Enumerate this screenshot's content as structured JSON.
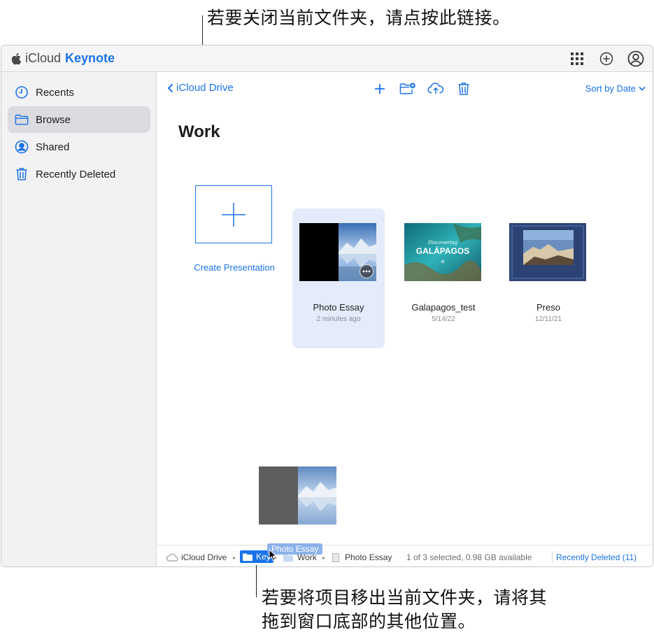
{
  "annotations": {
    "top": "若要关闭当前文件夹，请点按此链接。",
    "bottom_line1": "若要将项目移出当前文件夹，请将其",
    "bottom_line2": "拖到窗口底部的其他位置。"
  },
  "app": {
    "brand_icloud": "iCloud",
    "brand_app": "Keynote",
    "accent_color": "#1a73e8"
  },
  "top_icons": [
    "grid-icon",
    "add-circle-icon",
    "account-icon"
  ],
  "sidebar": {
    "items": [
      {
        "label": "Recents",
        "icon": "clock-icon"
      },
      {
        "label": "Browse",
        "icon": "folder-icon",
        "active": true
      },
      {
        "label": "Shared",
        "icon": "person-circle-icon"
      },
      {
        "label": "Recently Deleted",
        "icon": "trash-icon"
      }
    ]
  },
  "main": {
    "back_label": "iCloud Drive",
    "sort_label": "Sort by Date",
    "folder_title": "Work",
    "create_label": "Create Presentation",
    "toolbar_icons": [
      "plus-icon",
      "new-folder-icon",
      "upload-icon",
      "trash-icon"
    ],
    "files": [
      {
        "name": "Photo Essay",
        "date": "2 minutes ago",
        "selected": true
      },
      {
        "name": "Galapagos_test",
        "date": "5/14/22",
        "thumb_text_1": "Discovering",
        "thumb_text_2": "GALÁPAGOS"
      },
      {
        "name": "Preso",
        "date": "12/11/21"
      }
    ]
  },
  "drag": {
    "label": "Photo Essay"
  },
  "statusbar": {
    "crumbs": [
      "iCloud Drive",
      "Key",
      "Work",
      "Photo Essay"
    ],
    "status_text": "1 of 3 selected, 0.98 GB available",
    "recently_deleted": "Recently Deleted (11)"
  }
}
